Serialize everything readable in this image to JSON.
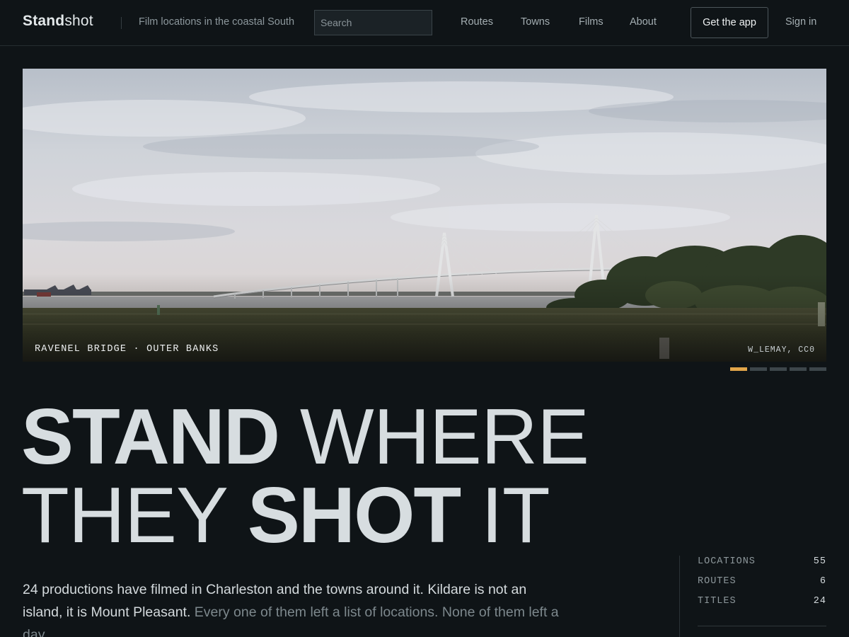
{
  "header": {
    "brand_bold": "Stand",
    "brand_light": "shot",
    "tagline": "Film locations in the coastal South",
    "search_placeholder": "Search",
    "nav": [
      {
        "label": "Routes"
      },
      {
        "label": "Towns"
      },
      {
        "label": "Films"
      },
      {
        "label": "About"
      }
    ],
    "cta_label": "Get the app",
    "signin_label": "Sign in"
  },
  "hero": {
    "caption": "RAVENEL BRIDGE · OUTER BANKS",
    "credit": "W_LEMAY, CC0",
    "slides": 5,
    "active_slide": 1,
    "accent_color": "#e1a54a"
  },
  "headline": {
    "line1_bold": "STAND",
    "line1_light": " WHERE",
    "line2_light": "THEY ",
    "line2_bold": "SHOT",
    "line2_end": " IT"
  },
  "lede": {
    "primary": "24 productions have filmed in Charleston and the towns around it. Kildare is not an island, it is Mount Pleasant.",
    "secondary": " Every one of them left a list of locations. None of them left a day."
  },
  "stats": [
    {
      "label": "LOCATIONS",
      "value": "55"
    },
    {
      "label": "ROUTES",
      "value": "6"
    },
    {
      "label": "TITLES",
      "value": "24"
    }
  ]
}
